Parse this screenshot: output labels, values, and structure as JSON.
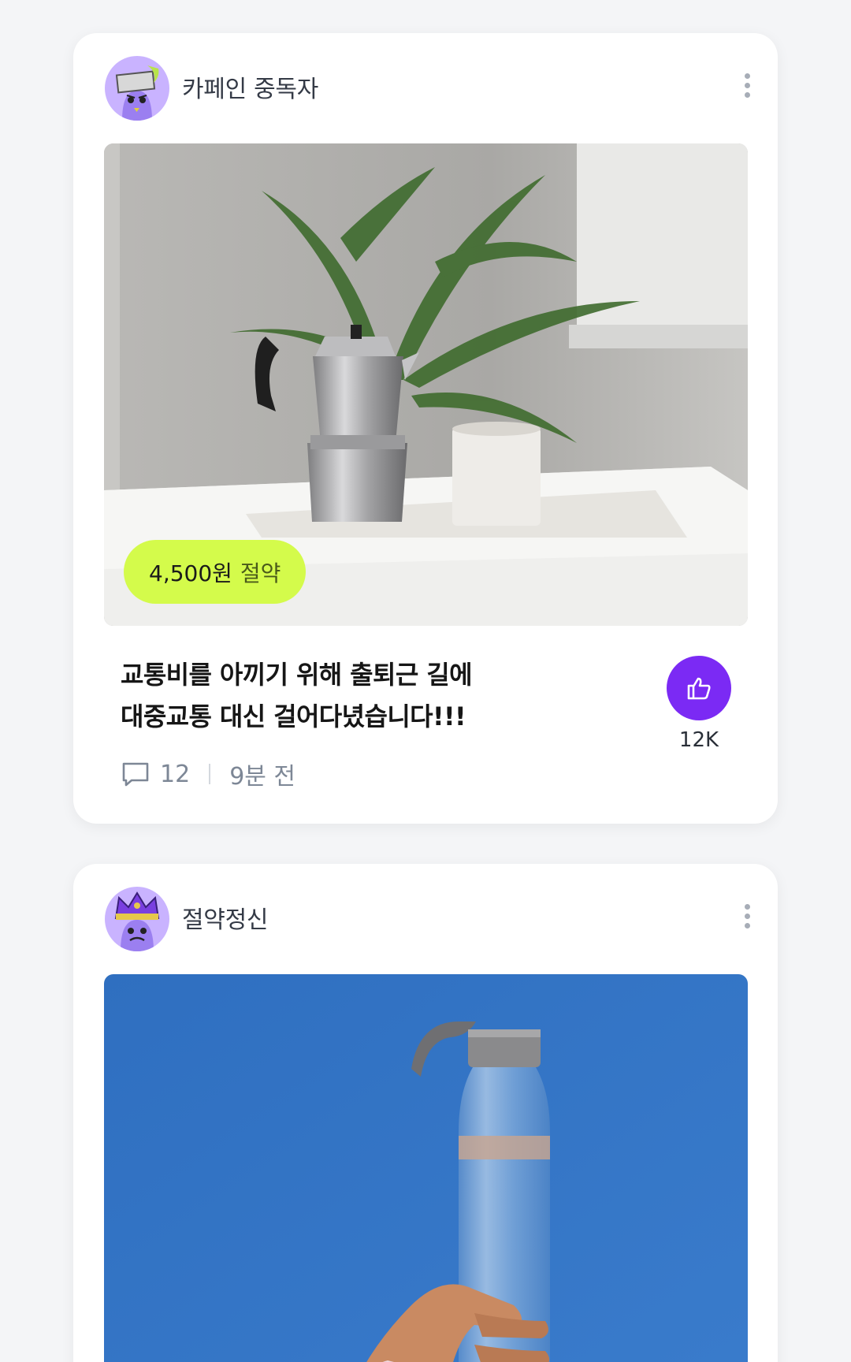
{
  "posts": [
    {
      "username": "카페인 중독자",
      "avatar_icon": "avatar-character-icon",
      "saving_amount": "4,500원",
      "saving_label": "절약",
      "title_lines": [
        "교통비를 아끼기 위해 출퇴근 길에",
        "대중교통 대신 걸어다녔습니다!!!"
      ],
      "comment_count": "12",
      "time_ago": "9분 전",
      "like_count": "12K"
    },
    {
      "username": "절약정신",
      "avatar_icon": "avatar-crown-character-icon"
    }
  ],
  "colors": {
    "background": "#f4f5f7",
    "card": "#ffffff",
    "saving_badge": "#d4fb4b",
    "like_button": "#7b2af4",
    "avatar_bg": "#c9b3ff"
  }
}
